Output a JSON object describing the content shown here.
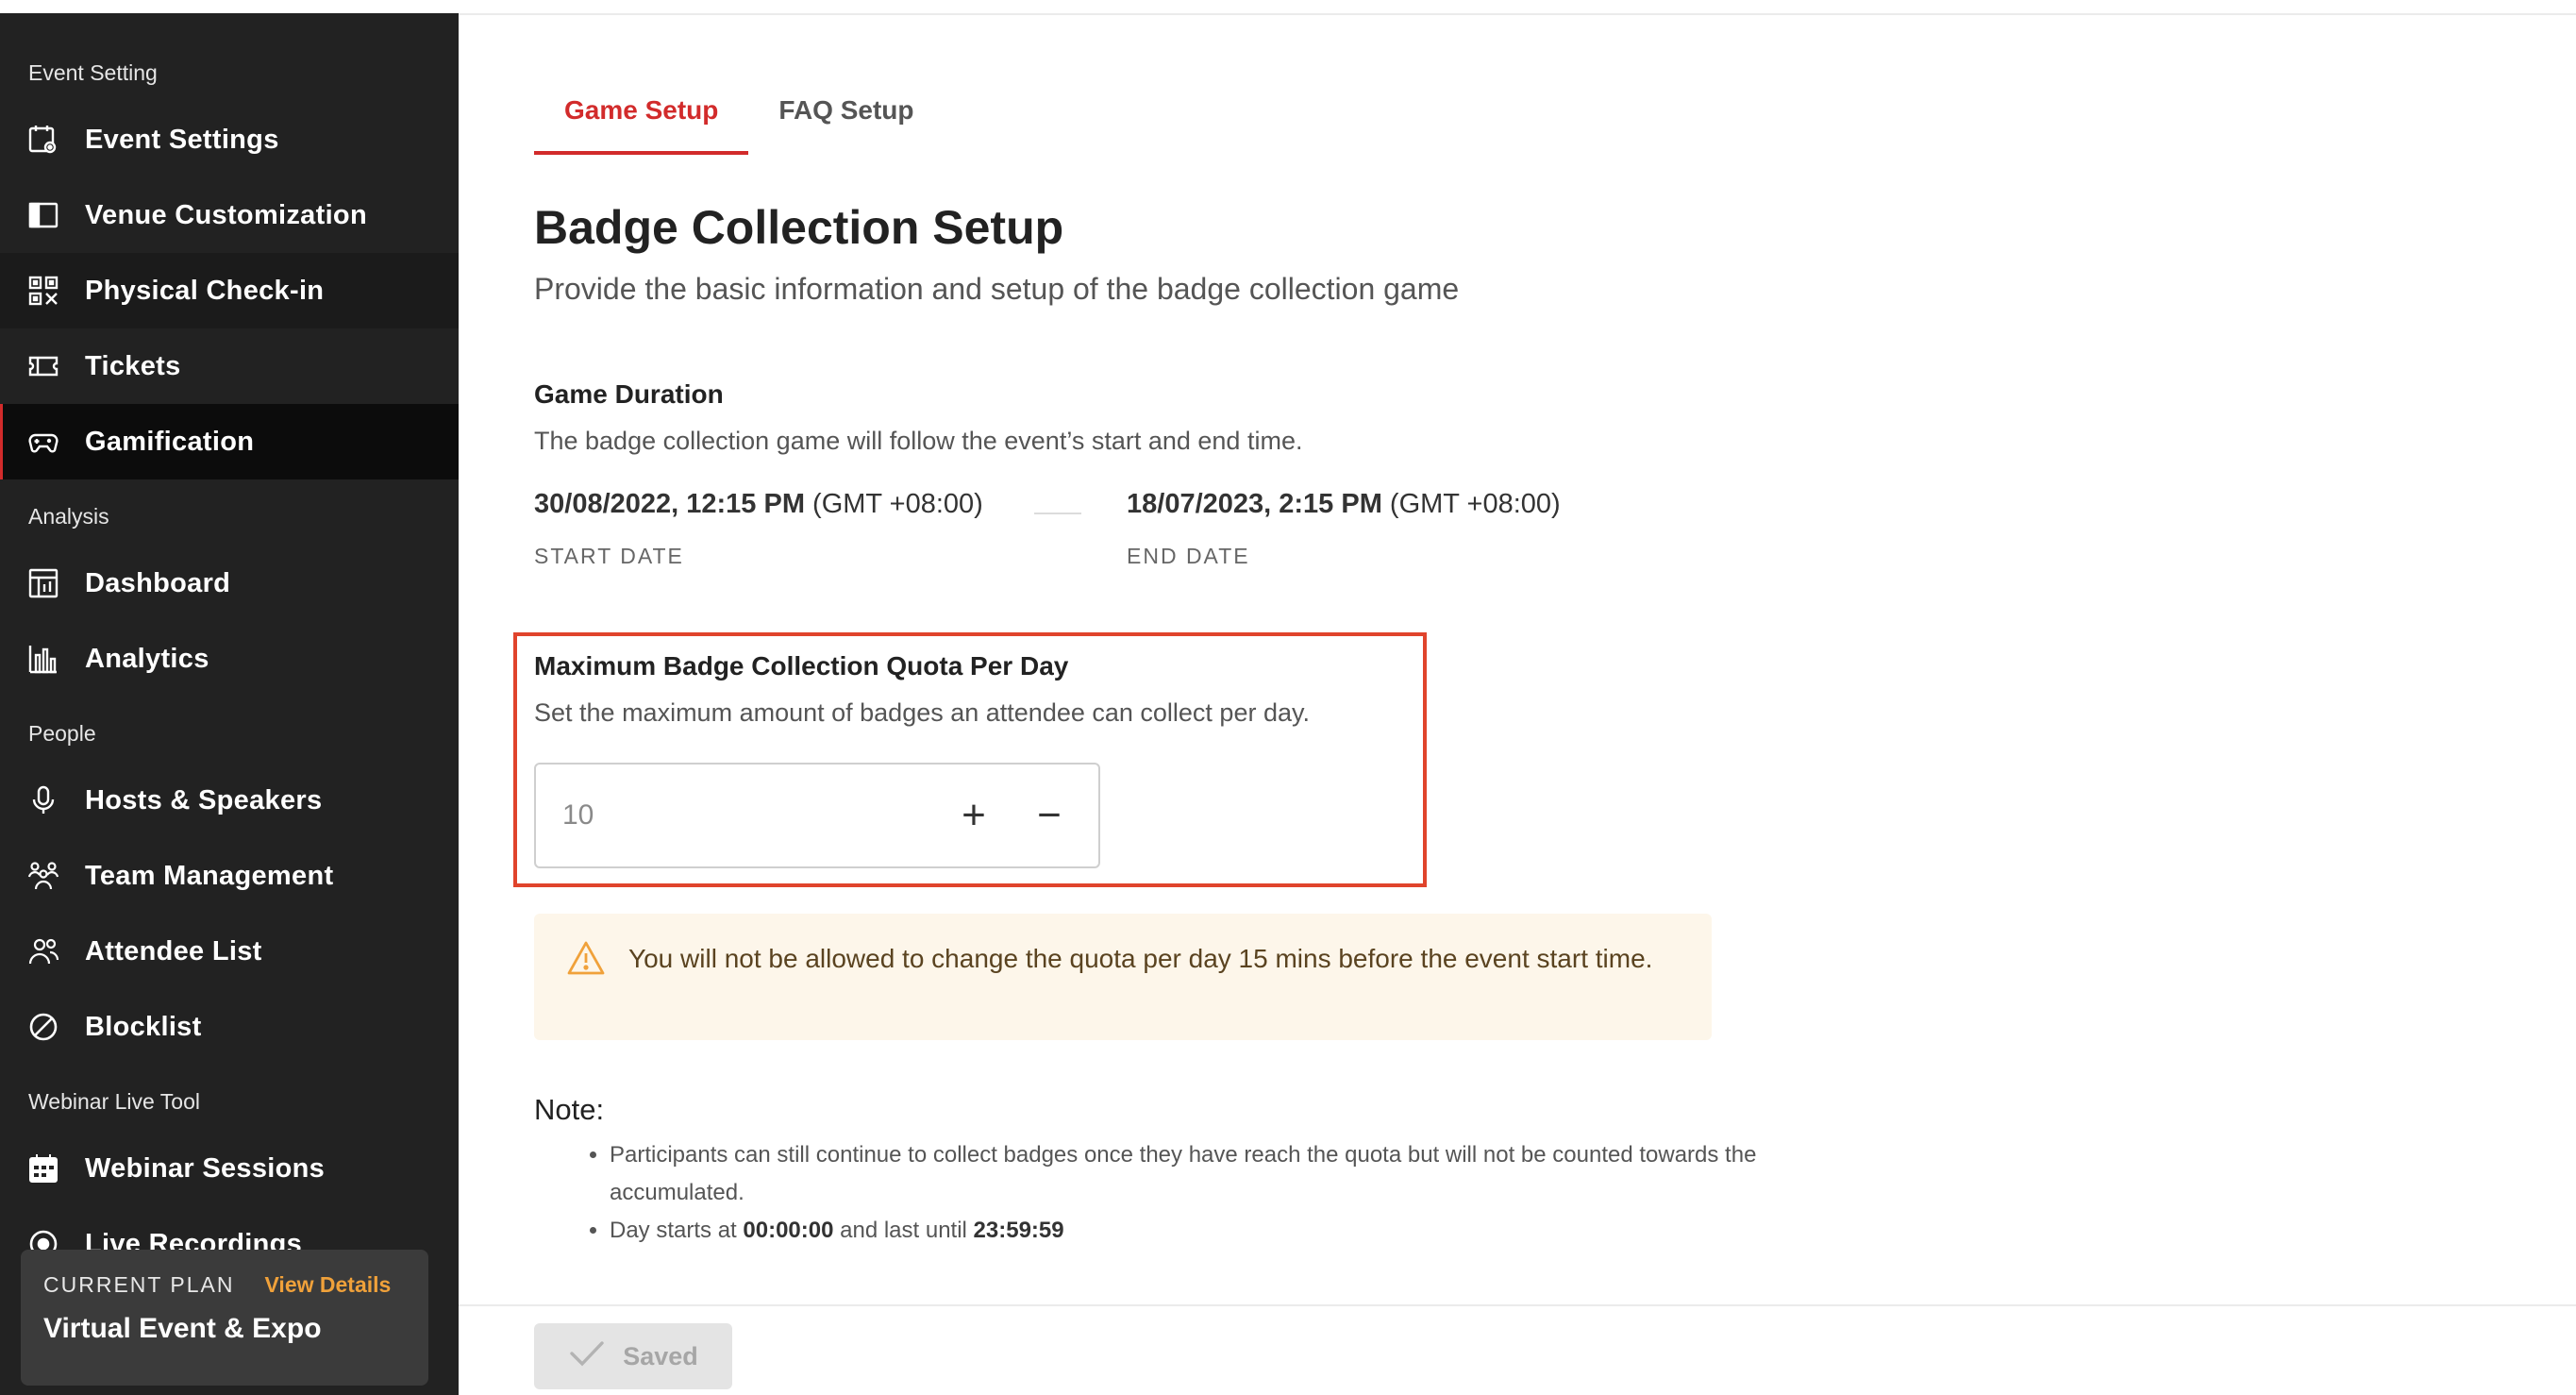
{
  "sidebar": {
    "sections": [
      {
        "title": "Event Setting"
      },
      {
        "title": "Analysis"
      },
      {
        "title": "People"
      },
      {
        "title": "Webinar Live Tool"
      }
    ],
    "items": [
      {
        "label": "Event Settings",
        "icon": "calendar-gear-icon"
      },
      {
        "label": "Venue Customization",
        "icon": "layout-panel-icon"
      },
      {
        "label": "Physical Check-in",
        "icon": "qr-code-icon"
      },
      {
        "label": "Tickets",
        "icon": "ticket-icon"
      },
      {
        "label": "Gamification",
        "icon": "gamepad-icon",
        "active": true
      },
      {
        "label": "Dashboard",
        "icon": "dashboard-icon"
      },
      {
        "label": "Analytics",
        "icon": "bar-chart-icon"
      },
      {
        "label": "Hosts & Speakers",
        "icon": "microphone-icon"
      },
      {
        "label": "Team Management",
        "icon": "team-icon"
      },
      {
        "label": "Attendee List",
        "icon": "attendees-icon"
      },
      {
        "label": "Blocklist",
        "icon": "block-icon"
      },
      {
        "label": "Webinar Sessions",
        "icon": "calendar-grid-icon"
      },
      {
        "label": "Live Recordings",
        "icon": "record-icon"
      }
    ],
    "plan": {
      "kicker": "CURRENT PLAN",
      "link": "View Details",
      "name": "Virtual Event & Expo"
    }
  },
  "tabs": [
    {
      "label": "Game Setup",
      "active": true
    },
    {
      "label": "FAQ Setup",
      "active": false
    }
  ],
  "page": {
    "title": "Badge Collection Setup",
    "subtitle": "Provide the basic information and setup of the badge collection game"
  },
  "duration": {
    "title": "Game Duration",
    "description": "The badge collection game will follow the event’s start and end time.",
    "start": {
      "value": "30/08/2022, 12:15 PM",
      "tz": "(GMT +08:00)",
      "caption": "START DATE"
    },
    "end": {
      "value": "18/07/2023, 2:15 PM",
      "tz": "(GMT +08:00)",
      "caption": "END DATE"
    }
  },
  "quota": {
    "title": "Maximum Badge Collection Quota Per Day",
    "description": "Set the maximum amount of badges an attendee can collect per day.",
    "value": "10",
    "increment_symbol": "+",
    "decrement_symbol": "−"
  },
  "warning": {
    "text": "You will not be allowed to change the quota per day 15 mins before the event start time.",
    "icon": "warning-triangle-icon",
    "color": "#f0a13a"
  },
  "note": {
    "title": "Note:",
    "items": [
      {
        "text": "Participants can still continue to collect badges once they have reach the quota but will not be counted towards the accumulated."
      }
    ],
    "day_prefix": "Day starts at ",
    "day_start": "00:00:00",
    "day_middle": " and last until ",
    "day_end": "23:59:59"
  },
  "footer": {
    "save_label": "Saved"
  },
  "colors": {
    "accent": "#d22b2b",
    "highlight_box": "#e0442c",
    "link": "#f0a13a",
    "sidebar_bg": "#222222"
  }
}
